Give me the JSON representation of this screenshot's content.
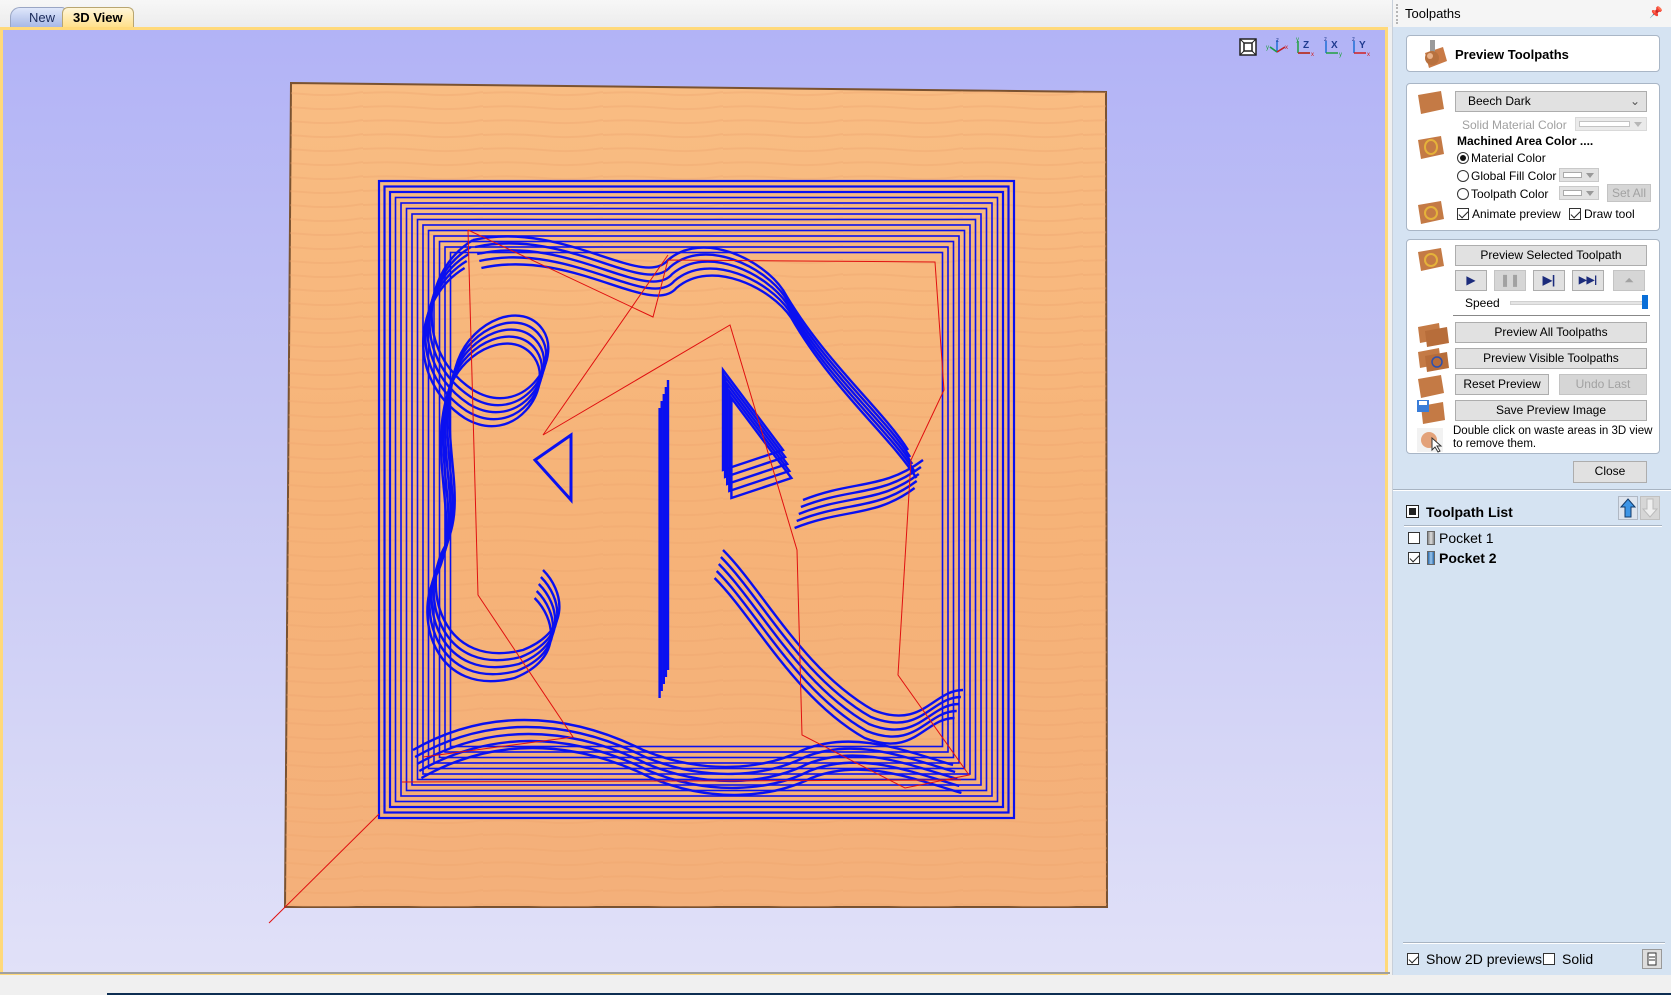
{
  "tabs": [
    {
      "label": "New",
      "active": false
    },
    {
      "label": "3D View",
      "active": true
    }
  ],
  "view_toolbar": [
    {
      "icon": "zoom-extents-icon",
      "tooltip": ""
    },
    {
      "icon": "iso-view-icon",
      "axes": [
        "y",
        "z",
        "x"
      ]
    },
    {
      "icon": "top-view-z-icon",
      "label": "Z",
      "axes": [
        "y",
        "z",
        "x"
      ]
    },
    {
      "icon": "front-view-x-icon",
      "label": "X",
      "axes": [
        "z",
        "x",
        "y"
      ]
    },
    {
      "icon": "side-view-y-icon",
      "label": "Y",
      "axes": [
        "z",
        "y",
        "x"
      ]
    }
  ],
  "scene": {
    "material_color": "#f7b77a",
    "toolpath_color": "#0a10f0",
    "rapid_move_color": "#e01010",
    "background_top": "#b2b3f6",
    "background_bottom": "#e1e1f8",
    "design_letter": "R"
  },
  "panel": {
    "title": "Toolpaths",
    "pin_icon": "pin-icon",
    "header_card": {
      "title": "Preview Toolpaths",
      "icon": "ball-nose-tool-icon"
    },
    "material": {
      "selected": "Beech Dark",
      "solid_material_color_label": "Solid Material Color",
      "machined_area_title": "Machined Area Color ....",
      "options": [
        {
          "label": "Material Color",
          "selected": true
        },
        {
          "label": "Global Fill Color",
          "selected": false
        },
        {
          "label": "Toolpath Color",
          "selected": false
        }
      ],
      "set_all_label": "Set All",
      "animate_preview": {
        "label": "Animate preview",
        "checked": true
      },
      "draw_tool": {
        "label": "Draw tool",
        "checked": true
      }
    },
    "preview": {
      "preview_selected_label": "Preview Selected Toolpath",
      "controls": [
        {
          "name": "play",
          "glyph": "▶",
          "enabled": true
        },
        {
          "name": "pause",
          "glyph": "❚❚",
          "enabled": false
        },
        {
          "name": "step",
          "glyph": "▶|",
          "enabled": true
        },
        {
          "name": "fast-forward",
          "glyph": "▶▶|",
          "enabled": true
        },
        {
          "name": "stop",
          "glyph": "⏶",
          "enabled": false
        }
      ],
      "speed_label": "Speed",
      "speed_value": 1.0,
      "preview_all_label": "Preview All Toolpaths",
      "preview_visible_label": "Preview Visible Toolpaths",
      "reset_label": "Reset Preview",
      "undo_label": "Undo Last",
      "save_image_label": "Save Preview Image",
      "hint_text": "Double click on waste areas in 3D view to remove them."
    },
    "close_label": "Close",
    "toolpath_list": {
      "title": "Toolpath List",
      "items": [
        {
          "label": "Pocket 1",
          "checked": false,
          "bold": false
        },
        {
          "label": "Pocket 2",
          "checked": true,
          "bold": true
        }
      ]
    },
    "footer": {
      "show_2d_previews": {
        "label": "Show 2D previews",
        "checked": true
      },
      "solid": {
        "label": "Solid",
        "checked": false
      }
    }
  }
}
